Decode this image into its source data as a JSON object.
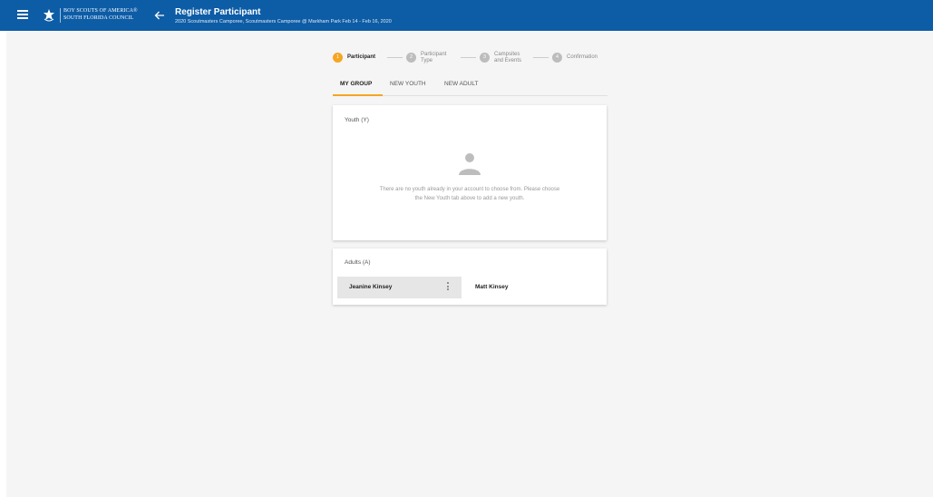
{
  "header": {
    "org_line1": "BOY SCOUTS OF AMERICA®",
    "org_line2": "SOUTH FLORIDA COUNCIL",
    "title": "Register Participant",
    "subtitle": "2020 Scoutmasters Camporee, Scoutmasters Camporee @ Markham Park Feb 14 - Feb 16, 2020",
    "menu_icon": "hamburger-menu-icon",
    "back_icon": "arrow-left-icon",
    "brand_color": "#0d5ca6"
  },
  "stepper": {
    "accent_color": "#f5a623",
    "steps": [
      {
        "number": "1",
        "label_line1": "Participant",
        "label_line2": "",
        "active": true
      },
      {
        "number": "2",
        "label_line1": "Participant",
        "label_line2": "Type",
        "active": false
      },
      {
        "number": "3",
        "label_line1": "Campsites",
        "label_line2": "and Events",
        "active": false
      },
      {
        "number": "4",
        "label_line1": "Confirmation",
        "label_line2": "",
        "active": false
      }
    ]
  },
  "tabs": [
    {
      "label": "MY GROUP",
      "active": true
    },
    {
      "label": "NEW YOUTH",
      "active": false
    },
    {
      "label": "NEW ADULT",
      "active": false
    }
  ],
  "youth": {
    "title": "Youth (Y)",
    "empty_line1": "There are no youth already in your account to choose from. Please choose",
    "empty_line2": "the New Youth tab above to add a new youth."
  },
  "adults": {
    "title": "Adults (A)",
    "items": [
      {
        "name": "Jeanine Kinsey",
        "selected": true
      },
      {
        "name": "Matt Kinsey",
        "selected": false
      }
    ]
  }
}
